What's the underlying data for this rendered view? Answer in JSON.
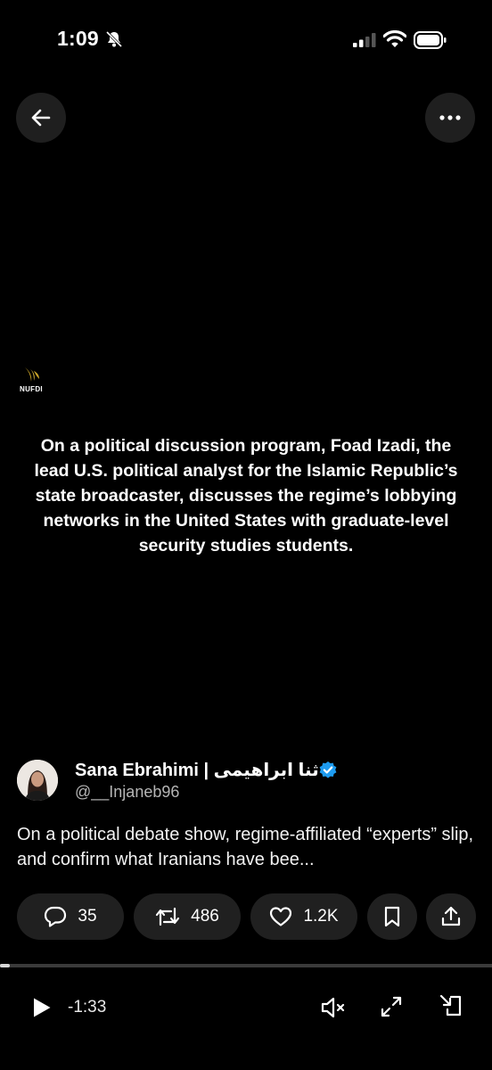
{
  "status_bar": {
    "time": "1:09"
  },
  "icons": {
    "back": "arrow-left-icon",
    "more": "more-horizontal-icon",
    "bell": "bell-slash-icon",
    "signal": "cellular-signal-icon",
    "wifi": "wifi-icon",
    "battery": "battery-icon",
    "verified": "verified-badge-icon",
    "reply": "reply-icon",
    "repost": "repost-icon",
    "like": "heart-icon",
    "bookmark": "bookmark-icon",
    "share": "share-icon",
    "play": "play-icon",
    "mute": "muted-speaker-icon",
    "expand": "expand-icon",
    "exit": "exit-fullscreen-icon"
  },
  "colors": {
    "accent": "#1d9bf0",
    "logo_gold": "#c9a227"
  },
  "video": {
    "logo_text": "NUFDI",
    "caption": "On a political discussion program, Foad Izadi, the lead U.S. political analyst for the Islamic Republic’s state broadcaster, discusses the regime’s lobbying networks in the United States with graduate-level security studies students."
  },
  "post": {
    "author_name": "Sana Ebrahimi | ثنا ابراهیمی",
    "handle": "@__Injaneb96",
    "text": "On a political debate show, regime-affiliated “experts” slip, and confirm what Iranians have bee..."
  },
  "actions": {
    "replies": "35",
    "reposts": "486",
    "likes": "1.2K"
  },
  "player": {
    "remaining": "-1:33",
    "progress": 0.02
  }
}
